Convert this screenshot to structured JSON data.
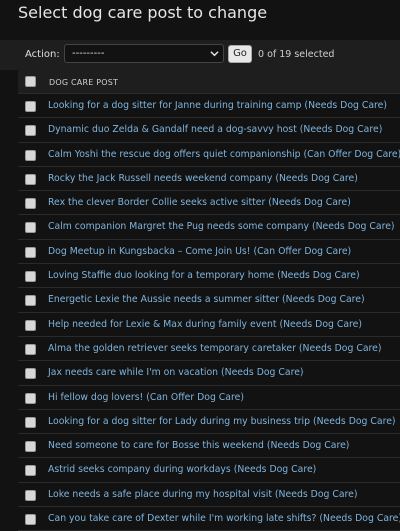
{
  "page": {
    "title": "Select dog care post to change"
  },
  "actions": {
    "label": "Action:",
    "select_value": "---------",
    "go_label": "Go",
    "counter": "0 of 19 selected"
  },
  "table": {
    "column_header": "DOG CARE POST",
    "rows": [
      "Looking for a dog sitter for Janne during training camp (Needs Dog Care)",
      "Dynamic duo Zelda & Gandalf need a dog-savvy host (Needs Dog Care)",
      "Calm Yoshi the rescue dog offers quiet companionship (Can Offer Dog Care)",
      "Rocky the Jack Russell needs weekend company (Needs Dog Care)",
      "Rex the clever Border Collie seeks active sitter (Needs Dog Care)",
      "Calm companion Margret the Pug needs some company (Needs Dog Care)",
      "Dog Meetup in Kungsbacka – Come Join Us! (Can Offer Dog Care)",
      "Loving Staffie duo looking for a temporary home (Needs Dog Care)",
      "Energetic Lexie the Aussie needs a summer sitter (Needs Dog Care)",
      "Help needed for Lexie & Max during family event (Needs Dog Care)",
      "Alma the golden retriever seeks temporary caretaker (Needs Dog Care)",
      "Jax needs care while I'm on vacation (Needs Dog Care)",
      "Hi fellow dog lovers! (Can Offer Dog Care)",
      "Looking for a dog sitter for Lady during my business trip (Needs Dog Care)",
      "Need someone to care for Bosse this weekend (Needs Dog Care)",
      "Astrid seeks company during workdays (Needs Dog Care)",
      "Loke needs a safe place during my hospital visit (Needs Dog Care)",
      "Can you take care of Dexter while I'm working late shifts? (Needs Dog Care)"
    ]
  },
  "colors": {
    "background": "#121212",
    "link": "#7fb4dd",
    "toolbar": "#1e1e1e"
  }
}
